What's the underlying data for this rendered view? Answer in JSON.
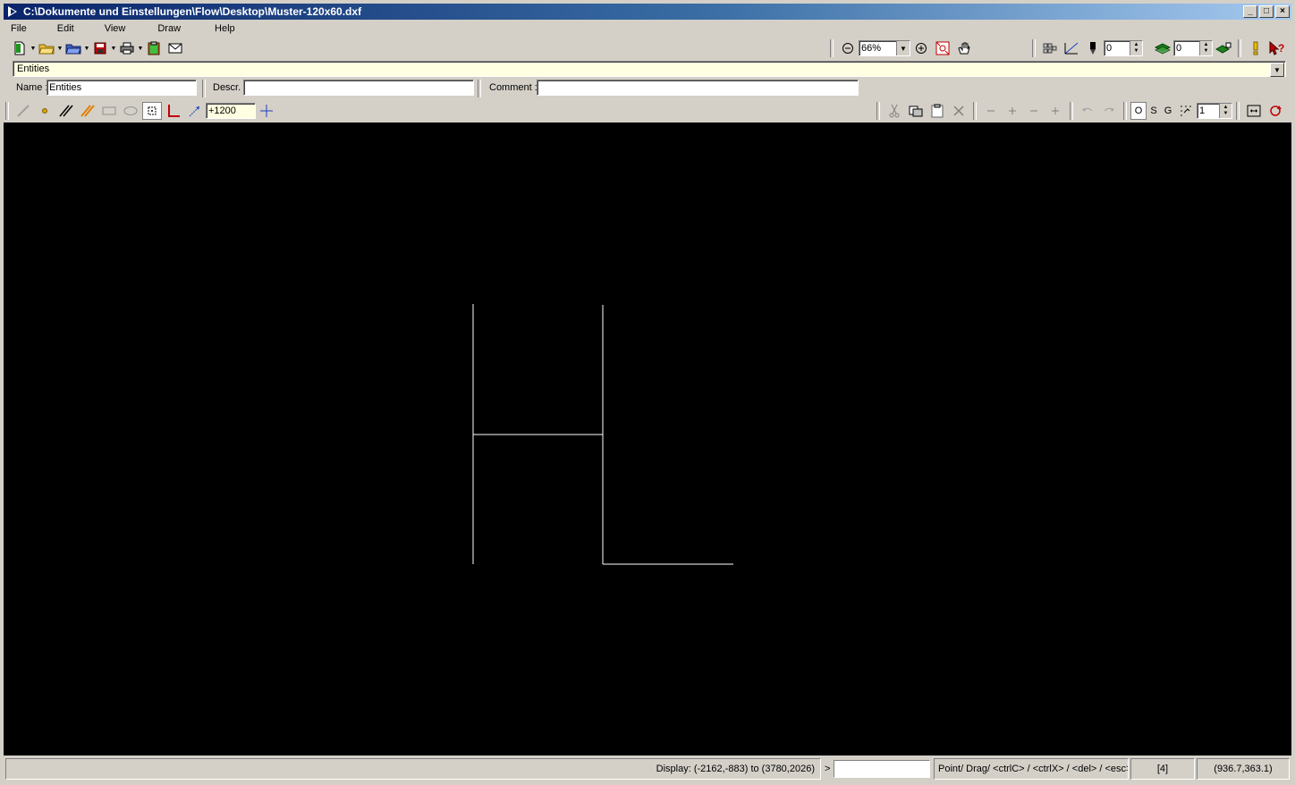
{
  "window": {
    "title": "C:\\Dokumente und Einstellungen\\Flow\\Desktop\\Muster-120x60.dxf",
    "minimize": "_",
    "maximize": "□",
    "close": "×"
  },
  "menu": {
    "items": [
      "File",
      "Edit",
      "View",
      "Draw",
      "Help"
    ]
  },
  "toolbar": {
    "zoom_value": "66%",
    "layer_value": "0",
    "color_value": "0"
  },
  "entities": {
    "selected": "Entities"
  },
  "properties": {
    "name_label": "Name :",
    "name_value": "Entities",
    "descr_label": "Descr.",
    "descr_value": "",
    "comment_label": "Comment :",
    "comment_value": ""
  },
  "draw_toolbar": {
    "coord_value": "+1200",
    "osnap_o": "O",
    "osnap_s": "S",
    "osnap_g": "G",
    "grid_value": "1"
  },
  "status": {
    "display_range": "Display: (-2162,-883) to (3780,2026)",
    "prompt_marker": ">",
    "command_value": "",
    "hint": "Point/ Drag/ <ctrlC> / <ctrlX> / <del> / <esc>",
    "count": "[4]",
    "cursor": "(936.7,363.1)"
  },
  "colors": {
    "canvas": "#000000",
    "entity_line": "#ffffff",
    "input_highlight": "#ffffe1",
    "title_start": "#0a246a",
    "title_end": "#a6caf0"
  }
}
